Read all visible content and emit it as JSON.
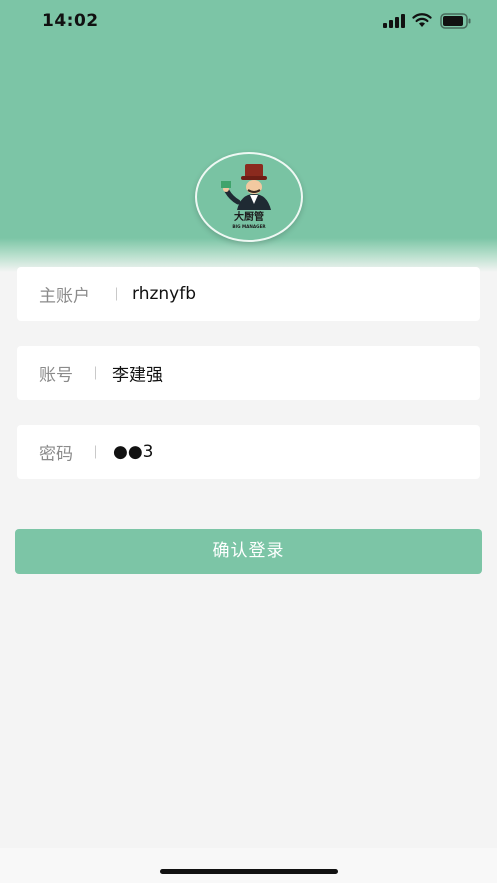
{
  "status_bar": {
    "time": "14:02"
  },
  "logo": {
    "chinese_text": "大厨管",
    "english_text": "BIG MANAGER",
    "icon": "chef-logo-icon"
  },
  "form": {
    "main_account": {
      "label": "主账户",
      "value": "rhznyfb"
    },
    "account": {
      "label": "账号",
      "value": "李建强"
    },
    "password": {
      "label": "密码",
      "value": "●●3"
    }
  },
  "login_button": {
    "label": "确认登录"
  },
  "colors": {
    "accent": "#7cc5a6",
    "background": "#f4f4f4"
  }
}
